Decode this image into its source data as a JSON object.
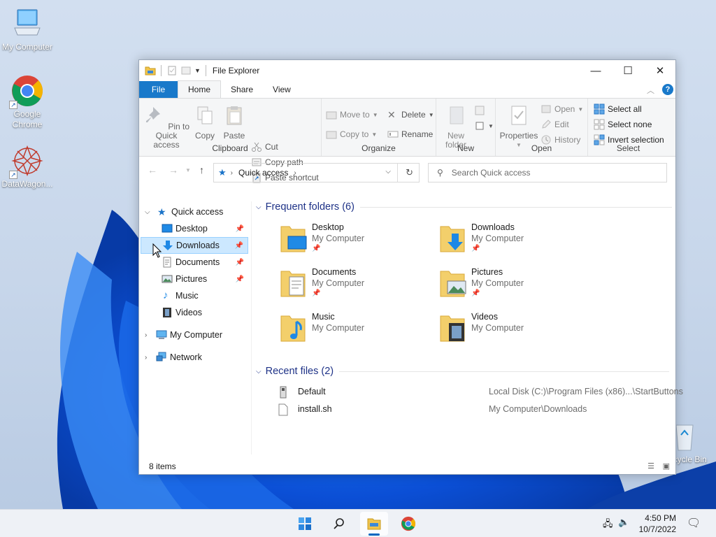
{
  "desktop": {
    "icons": [
      {
        "label": "My Computer"
      },
      {
        "label": "Google Chrome"
      },
      {
        "label": "DataWagon..."
      },
      {
        "label": "Recycle Bin"
      }
    ]
  },
  "window": {
    "title": "File Explorer",
    "tabs": {
      "file": "File",
      "home": "Home",
      "share": "Share",
      "view": "View"
    },
    "ribbon": {
      "clipboard": {
        "pin": "Pin to Quick access",
        "copy": "Copy",
        "paste": "Paste",
        "cut": "Cut",
        "copy_path": "Copy path",
        "paste_shortcut": "Paste shortcut",
        "label": "Clipboard"
      },
      "organize": {
        "move_to": "Move to",
        "copy_to": "Copy to",
        "delete": "Delete",
        "rename": "Rename",
        "label": "Organize"
      },
      "new": {
        "new_folder": "New folder",
        "label": "New"
      },
      "open": {
        "properties": "Properties",
        "open": "Open",
        "edit": "Edit",
        "history": "History",
        "label": "Open"
      },
      "select": {
        "select_all": "Select all",
        "select_none": "Select none",
        "invert": "Invert selection",
        "label": "Select"
      }
    },
    "address": {
      "path": "Quick access"
    },
    "search": {
      "placeholder": "Search Quick access"
    },
    "nav": {
      "quick_access": "Quick access",
      "items": [
        {
          "label": "Desktop"
        },
        {
          "label": "Downloads"
        },
        {
          "label": "Documents"
        },
        {
          "label": "Pictures"
        },
        {
          "label": "Music"
        },
        {
          "label": "Videos"
        }
      ],
      "my_computer": "My Computer",
      "network": "Network"
    },
    "frequent": {
      "header": "Frequent folders (6)",
      "items": [
        {
          "name": "Desktop",
          "location": "My Computer"
        },
        {
          "name": "Downloads",
          "location": "My Computer"
        },
        {
          "name": "Documents",
          "location": "My Computer"
        },
        {
          "name": "Pictures",
          "location": "My Computer"
        },
        {
          "name": "Music",
          "location": "My Computer"
        },
        {
          "name": "Videos",
          "location": "My Computer"
        }
      ]
    },
    "recent": {
      "header": "Recent files (2)",
      "items": [
        {
          "name": "Default",
          "path": "Local Disk (C:)\\Program Files (x86)...\\StartButtons"
        },
        {
          "name": "install.sh",
          "path": "My Computer\\Downloads"
        }
      ]
    },
    "status": {
      "items": "8 items"
    }
  },
  "taskbar": {
    "time": "4:50 PM",
    "date": "10/7/2022"
  },
  "colors": {
    "accent": "#1979ca",
    "selection": "#cce8ff",
    "section_header": "#1e3287"
  }
}
